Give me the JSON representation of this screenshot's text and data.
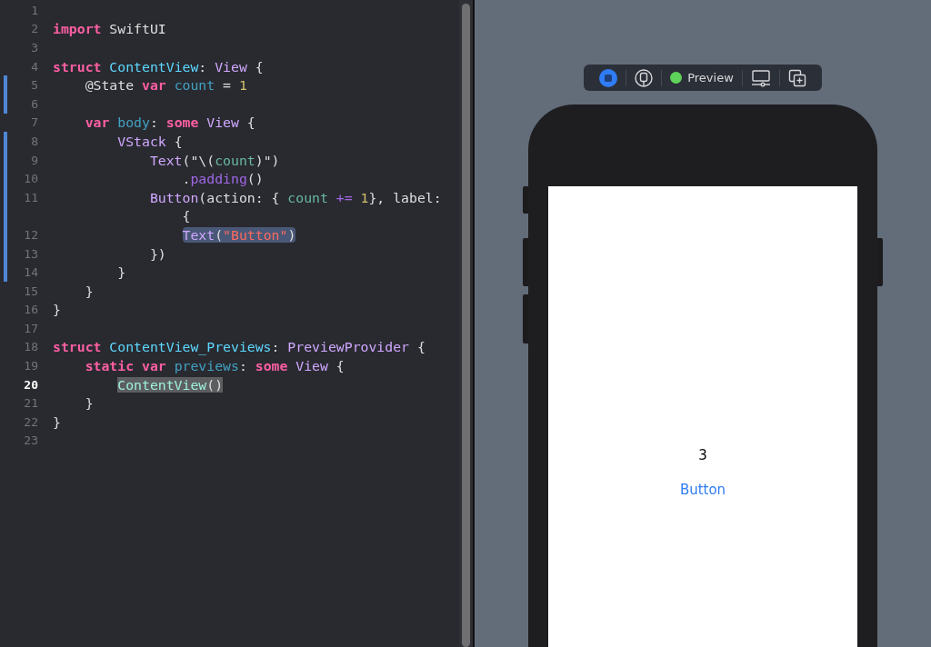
{
  "editor": {
    "lines": [
      {
        "number": "1",
        "changed": false,
        "current": false
      },
      {
        "number": "2",
        "changed": false,
        "current": false,
        "selected": false,
        "matched": false,
        "tokens": [
          {
            "kind": "keyword",
            "text": "import"
          },
          {
            "kind": "plain",
            "text": " SwiftUI"
          }
        ]
      },
      {
        "number": "3",
        "changed": false,
        "current": false
      },
      {
        "number": "4",
        "changed": false,
        "current": false,
        "selected": false,
        "matched": false,
        "tokens": [
          {
            "kind": "keyword",
            "text": "struct "
          },
          {
            "kind": "decl",
            "text": "ContentView"
          },
          {
            "kind": "plain",
            "text": ": "
          },
          {
            "kind": "type",
            "text": "View"
          },
          {
            "kind": "plain",
            "text": " {"
          }
        ]
      },
      {
        "number": "5",
        "changed": true,
        "current": false,
        "selected": false,
        "matched": false,
        "tokens": [
          {
            "kind": "plain",
            "text": "    @State "
          },
          {
            "kind": "keyword",
            "text": "var "
          },
          {
            "kind": "property",
            "text": "count"
          },
          {
            "kind": "plain",
            "text": " = "
          },
          {
            "kind": "number",
            "text": "1"
          }
        ]
      },
      {
        "number": "6",
        "changed": true,
        "current": false
      },
      {
        "number": "7",
        "changed": false,
        "current": false,
        "selected": false,
        "matched": false,
        "tokens": [
          {
            "kind": "keyword",
            "text": "    var "
          },
          {
            "kind": "property",
            "text": "body"
          },
          {
            "kind": "plain",
            "text": ": "
          },
          {
            "kind": "keyword",
            "text": "some "
          },
          {
            "kind": "type",
            "text": "View"
          },
          {
            "kind": "plain",
            "text": " {"
          }
        ]
      },
      {
        "number": "8",
        "changed": true,
        "current": false,
        "selected": false,
        "matched": false,
        "tokens": [
          {
            "kind": "type",
            "text": "        VStack"
          },
          {
            "kind": "plain",
            "text": " {"
          }
        ]
      },
      {
        "number": "9",
        "changed": true,
        "current": false,
        "selected": false,
        "matched": false,
        "tokens": [
          {
            "kind": "type",
            "text": "            Text"
          },
          {
            "kind": "plain",
            "text": "(\"\\("
          },
          {
            "kind": "variable",
            "text": "count"
          },
          {
            "kind": "plain",
            "text": ")\")"
          }
        ]
      },
      {
        "number": "10",
        "changed": true,
        "current": false,
        "selected": false,
        "matched": false,
        "tokens": [
          {
            "kind": "plain",
            "text": "                ."
          },
          {
            "kind": "method",
            "text": "padding"
          },
          {
            "kind": "plain",
            "text": "()"
          }
        ]
      },
      {
        "number": "11",
        "changed": true,
        "current": false,
        "selected": false,
        "matched": false,
        "tokens": [
          {
            "kind": "type",
            "text": "            Button"
          },
          {
            "kind": "plain",
            "text": "(action: { "
          },
          {
            "kind": "variable",
            "text": "count "
          },
          {
            "kind": "method",
            "text": "+= "
          },
          {
            "kind": "number",
            "text": "1"
          },
          {
            "kind": "plain",
            "text": "}, label:"
          }
        ]
      },
      {
        "changed": true,
        "selected": false,
        "matched": false,
        "tokens": [
          {
            "kind": "plain",
            "text": "                {"
          }
        ]
      },
      {
        "number": "12",
        "changed": true,
        "current": false,
        "selected": true,
        "matched": false,
        "tokens": [
          {
            "kind": "type",
            "text": "                Text"
          },
          {
            "kind": "plain",
            "text": "("
          },
          {
            "kind": "string",
            "text": "\"Button\""
          },
          {
            "kind": "plain",
            "text": ")"
          }
        ]
      },
      {
        "number": "13",
        "changed": true,
        "current": false,
        "selected": false,
        "matched": false,
        "tokens": [
          {
            "kind": "plain",
            "text": "            })"
          }
        ]
      },
      {
        "number": "14",
        "changed": true,
        "current": false,
        "selected": false,
        "matched": false,
        "tokens": [
          {
            "kind": "plain",
            "text": "        }"
          }
        ]
      },
      {
        "number": "15",
        "changed": false,
        "current": false,
        "selected": false,
        "matched": false,
        "tokens": [
          {
            "kind": "plain",
            "text": "    }"
          }
        ]
      },
      {
        "number": "16",
        "changed": false,
        "current": false,
        "selected": false,
        "matched": false,
        "tokens": [
          {
            "kind": "plain",
            "text": "}"
          }
        ]
      },
      {
        "number": "17",
        "changed": false,
        "current": false
      },
      {
        "number": "18",
        "changed": false,
        "current": false,
        "selected": false,
        "matched": false,
        "tokens": [
          {
            "kind": "keyword",
            "text": "struct "
          },
          {
            "kind": "decl",
            "text": "ContentView_Previews"
          },
          {
            "kind": "plain",
            "text": ": "
          },
          {
            "kind": "type",
            "text": "PreviewProvider"
          },
          {
            "kind": "plain",
            "text": " {"
          }
        ]
      },
      {
        "number": "19",
        "changed": false,
        "current": false,
        "selected": false,
        "matched": false,
        "tokens": [
          {
            "kind": "keyword",
            "text": "    static var "
          },
          {
            "kind": "property",
            "text": "previews"
          },
          {
            "kind": "plain",
            "text": ": "
          },
          {
            "kind": "keyword",
            "text": "some "
          },
          {
            "kind": "type",
            "text": "View"
          },
          {
            "kind": "plain",
            "text": " {"
          }
        ]
      },
      {
        "number": "20",
        "changed": false,
        "current": true,
        "selected": false,
        "matched": true,
        "tokens": [
          {
            "kind": "typeref",
            "text": "        ContentView"
          },
          {
            "kind": "plain",
            "text": "()"
          }
        ]
      },
      {
        "number": "21",
        "changed": false,
        "current": false,
        "selected": false,
        "matched": false,
        "tokens": [
          {
            "kind": "plain",
            "text": "    }"
          }
        ]
      },
      {
        "number": "22",
        "changed": false,
        "current": false,
        "selected": false,
        "matched": false,
        "tokens": [
          {
            "kind": "plain",
            "text": "}"
          }
        ]
      },
      {
        "number": "23",
        "changed": false,
        "current": false
      }
    ]
  },
  "preview_toolbar": {
    "items": [
      {
        "kind": "live",
        "selected": true
      },
      {
        "kind": "variants"
      },
      {
        "kind": "status",
        "label": "Preview"
      },
      {
        "kind": "device_settings"
      },
      {
        "kind": "duplicate"
      }
    ]
  },
  "preview": {
    "count_text": "3",
    "button_label": "Button"
  }
}
